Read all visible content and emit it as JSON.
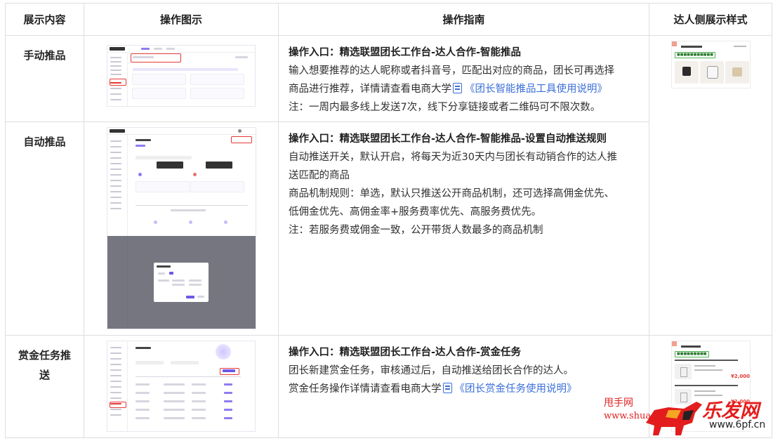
{
  "table": {
    "headers": [
      "展示内容",
      "操作图示",
      "操作指南",
      "达人侧展示样式"
    ],
    "rows": [
      {
        "content": "手动推品",
        "guide": [
          {
            "type": "entry",
            "text": "操作入口：精选联盟团长工作台-达人合作-智能推品"
          },
          {
            "type": "text",
            "text": "输入想要推荐的达人昵称或者抖音号，匹配出对应的商品，团长可再选择"
          },
          {
            "type": "mixed",
            "text": "商品进行推荐，详情请查看电商大学",
            "link": "《团长智能推品工具使用说明》"
          },
          {
            "type": "text",
            "text": "注：一周内最多线上发送7次，线下分享链接或者二维码可不限次数。"
          }
        ]
      },
      {
        "content": "自动推品",
        "guide": [
          {
            "type": "entry",
            "text": "操作入口：精选联盟团长工作台-达人合作-智能推品-设置自动推送规则"
          },
          {
            "type": "text",
            "text": "自动推送开关，默认开启，将每天为近30天内与团长有动销合作的达人推"
          },
          {
            "type": "text",
            "text": "送匹配的商品"
          },
          {
            "type": "text",
            "text": "商品机制规则：单选，默认只推送公开商品机制，还可选择高佣金优先、"
          },
          {
            "type": "text",
            "text": "低佣金优先、高佣金率+服务费率优先、高服务费优先。"
          },
          {
            "type": "text",
            "text": "注：若服务费或佣金一致，公开带货人数最多的商品机制"
          }
        ]
      },
      {
        "content_lines": [
          "赏金任务推",
          "送"
        ],
        "guide": [
          {
            "type": "entry",
            "text": "操作入口：精选联盟团长工作台-达人合作-赏金任务"
          },
          {
            "type": "text",
            "text": "团长新建赏金任务，审核通过后，自动推送给团长合作的达人。"
          },
          {
            "type": "mixed",
            "text": "赏金任务操作详情请查看电商大学",
            "link": "《团长赏金任务使用说明》"
          }
        ]
      }
    ]
  },
  "watermark": {
    "line1": "甩手网",
    "line2": "www.shua",
    "brand": "乐发网",
    "url": "www.6pf.cn"
  },
  "previews": {
    "price1": "¥2,000",
    "price2": "¥2,000"
  },
  "colors": {
    "link": "#3b6fd8",
    "border": "#dedede",
    "accent": "#8e7cf0",
    "watermark": "#e31d1d"
  }
}
